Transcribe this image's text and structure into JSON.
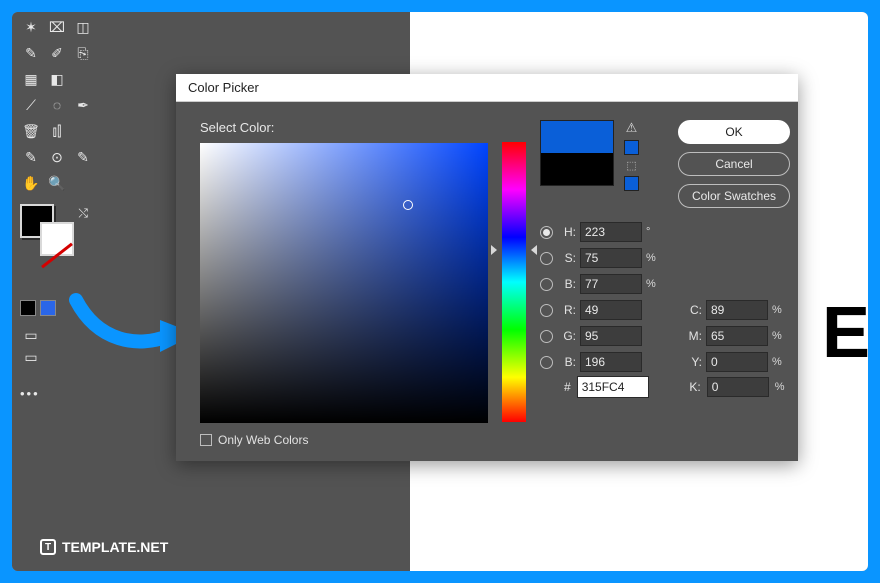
{
  "dialog": {
    "title": "Color Picker",
    "select_label": "Select Color:",
    "ok": "OK",
    "cancel": "Cancel",
    "swatches": "Color Swatches",
    "only_web": "Only Web Colors",
    "fields": {
      "H": {
        "label": "H:",
        "value": "223",
        "unit": "°"
      },
      "S": {
        "label": "S:",
        "value": "75",
        "unit": "%"
      },
      "Bv": {
        "label": "B:",
        "value": "77",
        "unit": "%"
      },
      "R": {
        "label": "R:",
        "value": "49"
      },
      "G": {
        "label": "G:",
        "value": "95"
      },
      "B": {
        "label": "B:",
        "value": "196"
      },
      "C": {
        "label": "C:",
        "value": "89",
        "unit": "%"
      },
      "M": {
        "label": "M:",
        "value": "65",
        "unit": "%"
      },
      "Y": {
        "label": "Y:",
        "value": "0",
        "unit": "%"
      },
      "K": {
        "label": "K:",
        "value": "0",
        "unit": "%"
      },
      "hex": {
        "label": "#",
        "value": "315FC4"
      }
    },
    "preview_new": "#0a5fd8",
    "preview_old": "#000000"
  },
  "watermark": {
    "icon": "T",
    "text": "TEMPLATE.NET"
  },
  "canvas_text": "EI"
}
